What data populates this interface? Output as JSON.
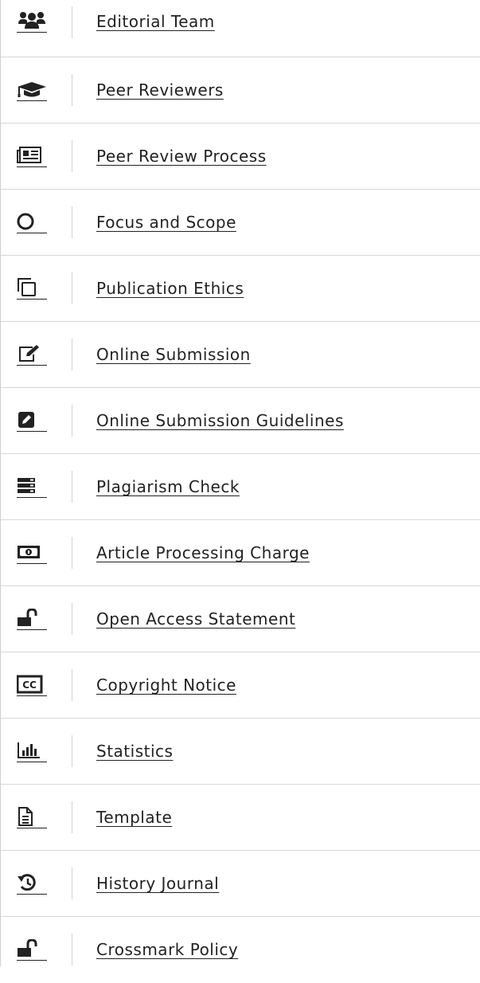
{
  "menu": {
    "items": [
      {
        "label": "Editorial Team",
        "icon": "users-icon"
      },
      {
        "label": "Peer Reviewers",
        "icon": "graduation-cap-icon"
      },
      {
        "label": "Peer Review Process",
        "icon": "newspaper-icon"
      },
      {
        "label": "Focus and Scope",
        "icon": "circle-icon"
      },
      {
        "label": "Publication Ethics",
        "icon": "copy-icon"
      },
      {
        "label": "Online Submission",
        "icon": "edit-icon"
      },
      {
        "label": "Online Submission Guidelines",
        "icon": "pencil-square-icon"
      },
      {
        "label": "Plagiarism Check",
        "icon": "server-icon"
      },
      {
        "label": "Article Processing Charge",
        "icon": "money-bill-icon"
      },
      {
        "label": "Open Access Statement",
        "icon": "unlock-icon"
      },
      {
        "label": "Copyright Notice",
        "icon": "creative-commons-icon"
      },
      {
        "label": "Statistics",
        "icon": "bar-chart-icon"
      },
      {
        "label": "Template",
        "icon": "file-text-icon"
      },
      {
        "label": "History Journal",
        "icon": "history-icon"
      },
      {
        "label": "Crossmark Policy",
        "icon": "unlock-icon"
      }
    ]
  }
}
